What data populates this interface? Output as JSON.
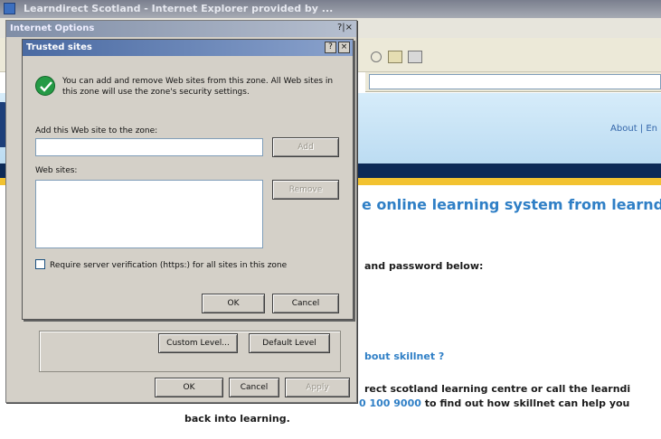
{
  "ie_window": {
    "title": "Learndirect Scotland - Internet Explorer provided by ..."
  },
  "web_page": {
    "nav_links": "About | En",
    "headline": "e online learning system from learndire",
    "text_login": "and password below:",
    "link_about": "bout skillnet ?",
    "text_contact_1": "rect scotland learning centre or call the learndi",
    "text_phone": "0 100 9000",
    "text_contact_2": " to find out how skillnet can help you",
    "text_back": "back into learning."
  },
  "internet_options": {
    "title": "Internet Options",
    "title_buttons": "?|×",
    "custom_level_label": "Custom Level...",
    "default_level_label": "Default Level",
    "ok_label": "OK",
    "cancel_label": "Cancel",
    "apply_label": "Apply"
  },
  "trusted_sites": {
    "title": "Trusted sites",
    "help_button": "?",
    "close_button": "×",
    "info_text": "You can add and remove Web sites from this zone. All Web sites in this zone will use the zone's security settings.",
    "add_label": "Add this Web site to the zone:",
    "add_input_value": "",
    "add_button_label": "Add",
    "websites_label": "Web sites:",
    "websites": [],
    "remove_button_label": "Remove",
    "require_https_label": "Require server verification (https:) for all sites in this zone",
    "require_https_checked": false,
    "ok_label": "OK",
    "cancel_label": "Cancel"
  }
}
